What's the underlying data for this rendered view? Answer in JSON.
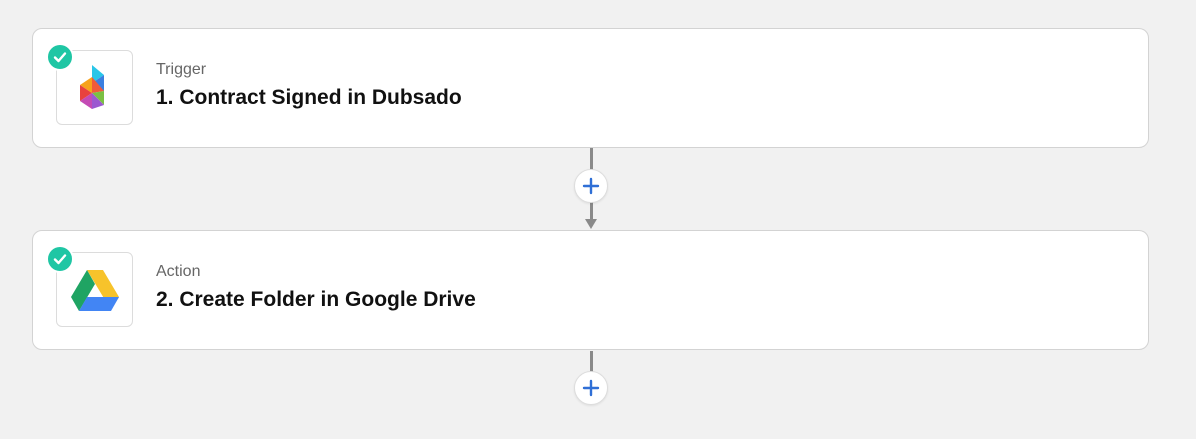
{
  "steps": [
    {
      "kind": "Trigger",
      "title": "1. Contract Signed in Dubsado",
      "app_icon": "dubsado-icon",
      "status_icon": "check-icon"
    },
    {
      "kind": "Action",
      "title": "2. Create Folder in Google Drive",
      "app_icon": "google-drive-icon",
      "status_icon": "check-icon"
    }
  ],
  "add_step_icon": "plus-icon",
  "colors": {
    "background": "#f1f1f1",
    "card": "#ffffff",
    "check_badge": "#1fc6a4",
    "plus_blue": "#2f6fd6",
    "connector": "#8a8a8a"
  }
}
